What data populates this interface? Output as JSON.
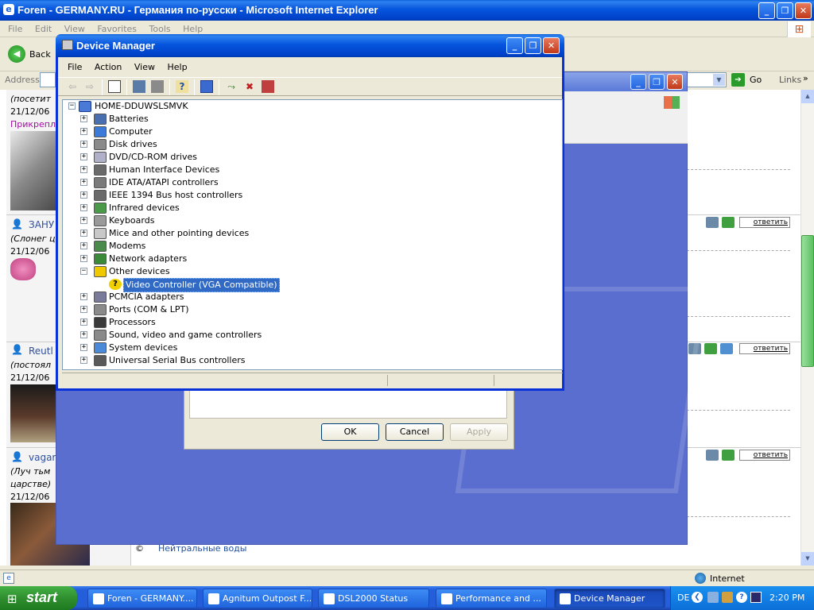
{
  "ie": {
    "title": "Foren - GERMANY.RU - Германия по-русски - Microsoft Internet Explorer",
    "menu": [
      "File",
      "Edit",
      "View",
      "Favorites",
      "Tools",
      "Help"
    ],
    "back": "Back",
    "address_label": "Address",
    "go": "Go",
    "links": "Links",
    "status": "Internet"
  },
  "forum": {
    "posts": [
      {
        "lines": [
          "(посетит",
          "21/12/06",
          "Прикрепл"
        ]
      },
      {
        "user": "ЗАНУ",
        "lines": [
          "(Слонег ц",
          "21/12/06"
        ]
      },
      {
        "user": "Reutl",
        "lines": [
          "(постоял",
          "21/12/06"
        ]
      },
      {
        "user": "vagar",
        "lines": [
          "(Луч тьм",
          "царстве)",
          "21/12/06"
        ]
      }
    ],
    "reply": "ответить",
    "footer": "Нейтральные воды"
  },
  "dialog": {
    "ok": "OK",
    "cancel": "Cancel",
    "apply": "Apply"
  },
  "dm": {
    "title": "Device Manager",
    "menu": [
      "File",
      "Action",
      "View",
      "Help"
    ],
    "root": "HOME-DDUWSLSMVK",
    "items": [
      {
        "label": "Batteries",
        "icon": "battery-icon",
        "color": "#4a6fb0",
        "exp": "+"
      },
      {
        "label": "Computer",
        "icon": "computer-icon",
        "color": "#3b7ad8",
        "exp": "+"
      },
      {
        "label": "Disk drives",
        "icon": "disk-drive-icon",
        "color": "#8a8a8a",
        "exp": "+"
      },
      {
        "label": "DVD/CD-ROM drives",
        "icon": "cdrom-icon",
        "color": "#b0b0c8",
        "exp": "+"
      },
      {
        "label": "Human Interface Devices",
        "icon": "hid-icon",
        "color": "#6a6a6a",
        "exp": "+"
      },
      {
        "label": "IDE ATA/ATAPI controllers",
        "icon": "ide-icon",
        "color": "#7a7a7a",
        "exp": "+"
      },
      {
        "label": "IEEE 1394 Bus host controllers",
        "icon": "ieee1394-icon",
        "color": "#6a6a6a",
        "exp": "+"
      },
      {
        "label": "Infrared devices",
        "icon": "infrared-icon",
        "color": "#4a9a4a",
        "exp": "+"
      },
      {
        "label": "Keyboards",
        "icon": "keyboard-icon",
        "color": "#9a9a9a",
        "exp": "+"
      },
      {
        "label": "Mice and other pointing devices",
        "icon": "mouse-icon",
        "color": "#c8c8c8",
        "exp": "+"
      },
      {
        "label": "Modems",
        "icon": "modem-icon",
        "color": "#4a8a4a",
        "exp": "+"
      },
      {
        "label": "Network adapters",
        "icon": "network-adapter-icon",
        "color": "#3a8a3a",
        "exp": "+"
      },
      {
        "label": "Other devices",
        "icon": "unknown-device-icon",
        "color": "#f0c800",
        "exp": "−"
      }
    ],
    "child": {
      "label": "Video Controller (VGA Compatible)",
      "icon": "warning-device-icon"
    },
    "items2": [
      {
        "label": "PCMCIA adapters",
        "icon": "pcmcia-icon",
        "color": "#7a7a9a",
        "exp": "+"
      },
      {
        "label": "Ports (COM & LPT)",
        "icon": "port-icon",
        "color": "#8a8a8a",
        "exp": "+"
      },
      {
        "label": "Processors",
        "icon": "processor-icon",
        "color": "#3a3a3a",
        "exp": "+"
      },
      {
        "label": "Sound, video and game controllers",
        "icon": "sound-icon",
        "color": "#8a8a8a",
        "exp": "+"
      },
      {
        "label": "System devices",
        "icon": "system-device-icon",
        "color": "#4a8ad8",
        "exp": "+"
      },
      {
        "label": "Universal Serial Bus controllers",
        "icon": "usb-icon",
        "color": "#5a5a5a",
        "exp": "+"
      }
    ]
  },
  "taskbar": {
    "start": "start",
    "lang": "DE",
    "clock": "2:20 PM",
    "tasks": [
      {
        "label": "Foren - GERMANY....",
        "icon": "ie-icon",
        "active": false
      },
      {
        "label": "Agnitum Outpost F...",
        "icon": "firewall-icon",
        "active": false
      },
      {
        "label": "DSL2000 Status",
        "icon": "network-icon",
        "active": false
      },
      {
        "label": "Performance and ...",
        "icon": "control-panel-icon",
        "active": false
      },
      {
        "label": "Device Manager",
        "icon": "device-manager-icon",
        "active": true
      }
    ]
  }
}
